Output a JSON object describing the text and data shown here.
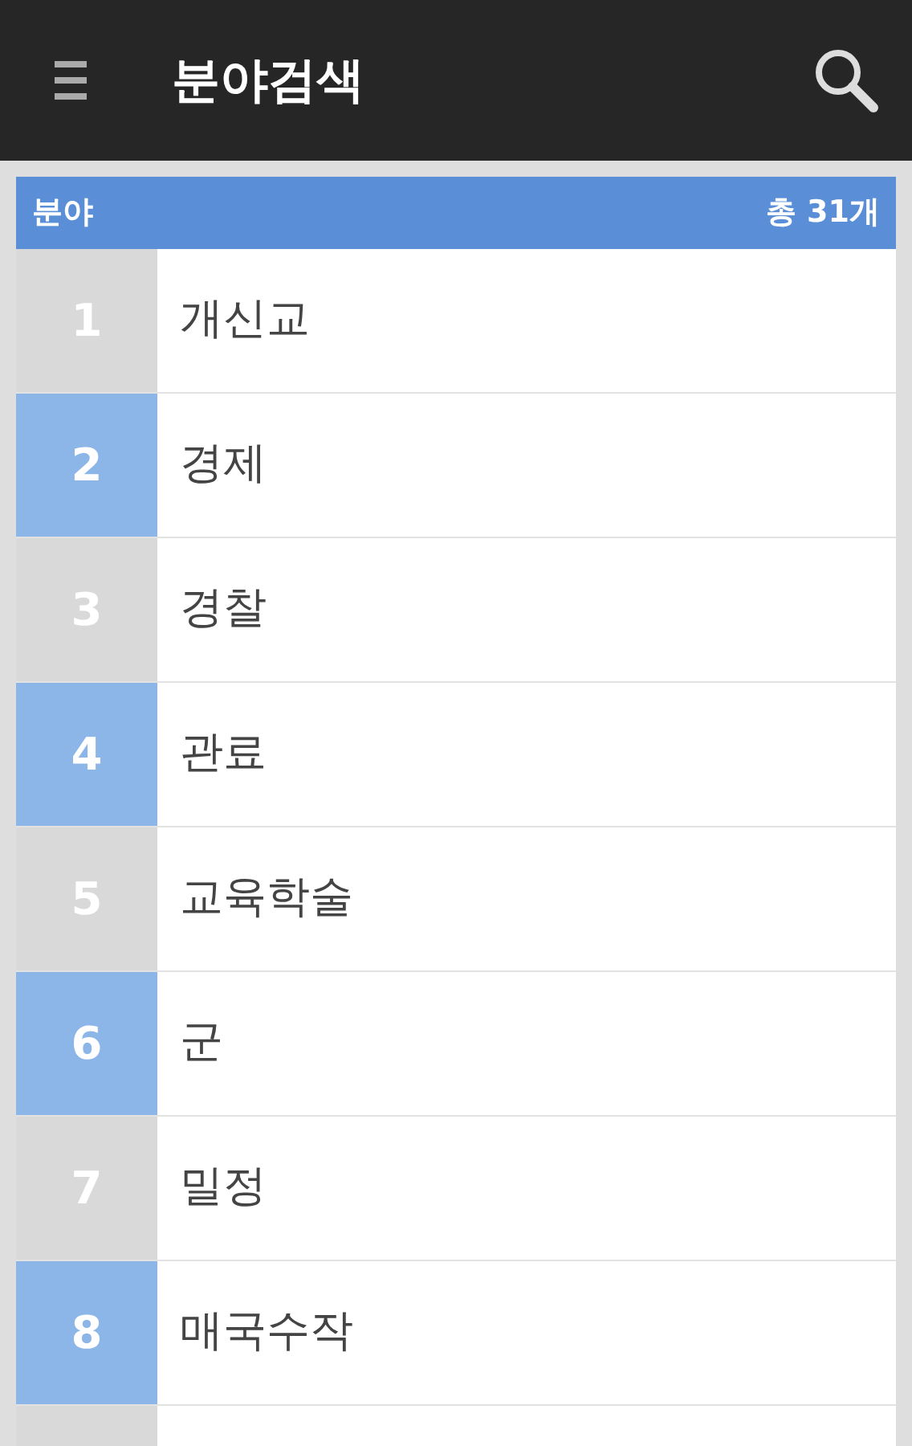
{
  "app_bar": {
    "title": "분야검색"
  },
  "list_header": {
    "label": "분야",
    "count": "총 31개"
  },
  "rows": [
    {
      "number": "1",
      "label": "개신교"
    },
    {
      "number": "2",
      "label": "경제"
    },
    {
      "number": "3",
      "label": "경찰"
    },
    {
      "number": "4",
      "label": "관료"
    },
    {
      "number": "5",
      "label": "교육학술"
    },
    {
      "number": "6",
      "label": "군"
    },
    {
      "number": "7",
      "label": "밀정"
    },
    {
      "number": "8",
      "label": "매국수작"
    }
  ]
}
